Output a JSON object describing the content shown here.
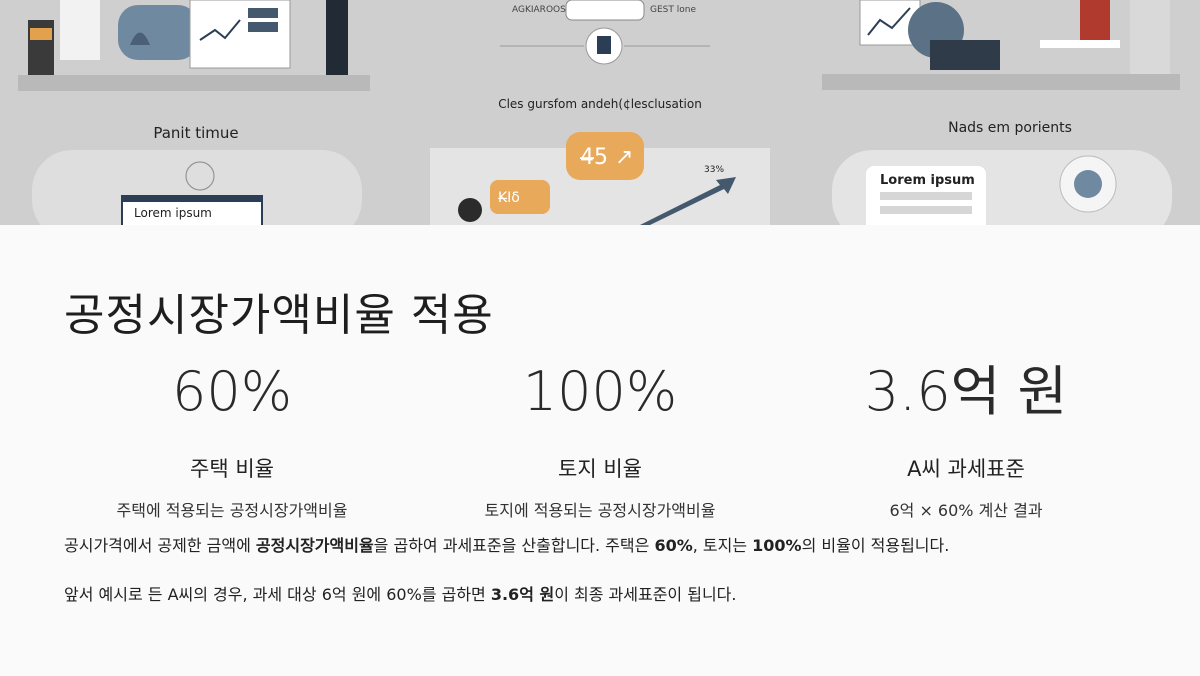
{
  "banner": {
    "left_caption": "Panit timue",
    "center_caption": "Cles gursfom andeh(¢lesclusation",
    "right_caption": "Nads em porients",
    "left_card_text": "Lorem ipsum",
    "right_card_text": "Lorem ipsum",
    "center_badge": "4̶5 ↗",
    "center_percent": "33%",
    "center_bubble": "Κ̶Ιδ",
    "top_label_left": "AGKIAROOS",
    "top_label_right": "GEST lone"
  },
  "section": {
    "title": "공정시장가액비율 적용"
  },
  "stats": [
    {
      "value": "60%",
      "label": "주택 비율",
      "desc": "주택에 적용되는 공정시장가액비율"
    },
    {
      "value": "100%",
      "label": "토지 비율",
      "desc": "토지에 적용되는 공정시장가액비율"
    },
    {
      "value": "3.6억 원",
      "label": "A씨 과세표준",
      "desc": "6억 × 60% 계산 결과"
    }
  ],
  "paragraph1": {
    "a": "공시가격에서 공제한 금액에 ",
    "b": "공정시장가액비율",
    "c": "을 곱하여 과세표준을 산출합니다. 주택은 ",
    "d": "60%",
    "e": ", 토지는 ",
    "f": "100%",
    "g": "의 비율이 적용됩니다."
  },
  "paragraph2": {
    "a": "앞서 예시로 든 A씨의 경우, 과세 대상 6억 원에 60%를 곱하면 ",
    "b": "3.6억 원",
    "c": "이 최종 과세표준이 됩니다."
  },
  "colors": {
    "banner_bg": "#cfcfcf",
    "accent_orange": "#e8a95a",
    "navy": "#2c3e55"
  }
}
